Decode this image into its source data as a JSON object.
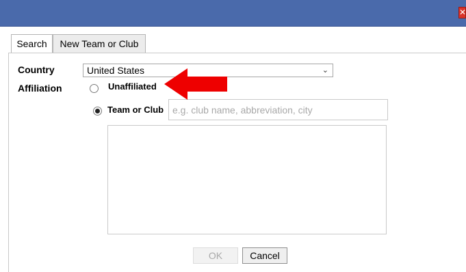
{
  "window": {
    "close_glyph": "✕"
  },
  "tabs": [
    {
      "label": "Search",
      "active": true
    },
    {
      "label": "New Team or Club",
      "active": false
    }
  ],
  "form": {
    "country_label": "Country",
    "country_value": "United States",
    "affiliation_label": "Affiliation",
    "options": [
      {
        "label": "Unaffiliated",
        "selected": false
      },
      {
        "label": "Team or Club",
        "selected": true
      }
    ],
    "team_input_value": "",
    "team_input_placeholder": "e.g. club name, abbreviation, city"
  },
  "buttons": {
    "ok_label": "OK",
    "ok_enabled": false,
    "cancel_label": "Cancel"
  },
  "annotation": {
    "arrow_color": "#ee0000"
  },
  "colors": {
    "titlebar": "#4a6aab",
    "close_button": "#d9332b"
  }
}
